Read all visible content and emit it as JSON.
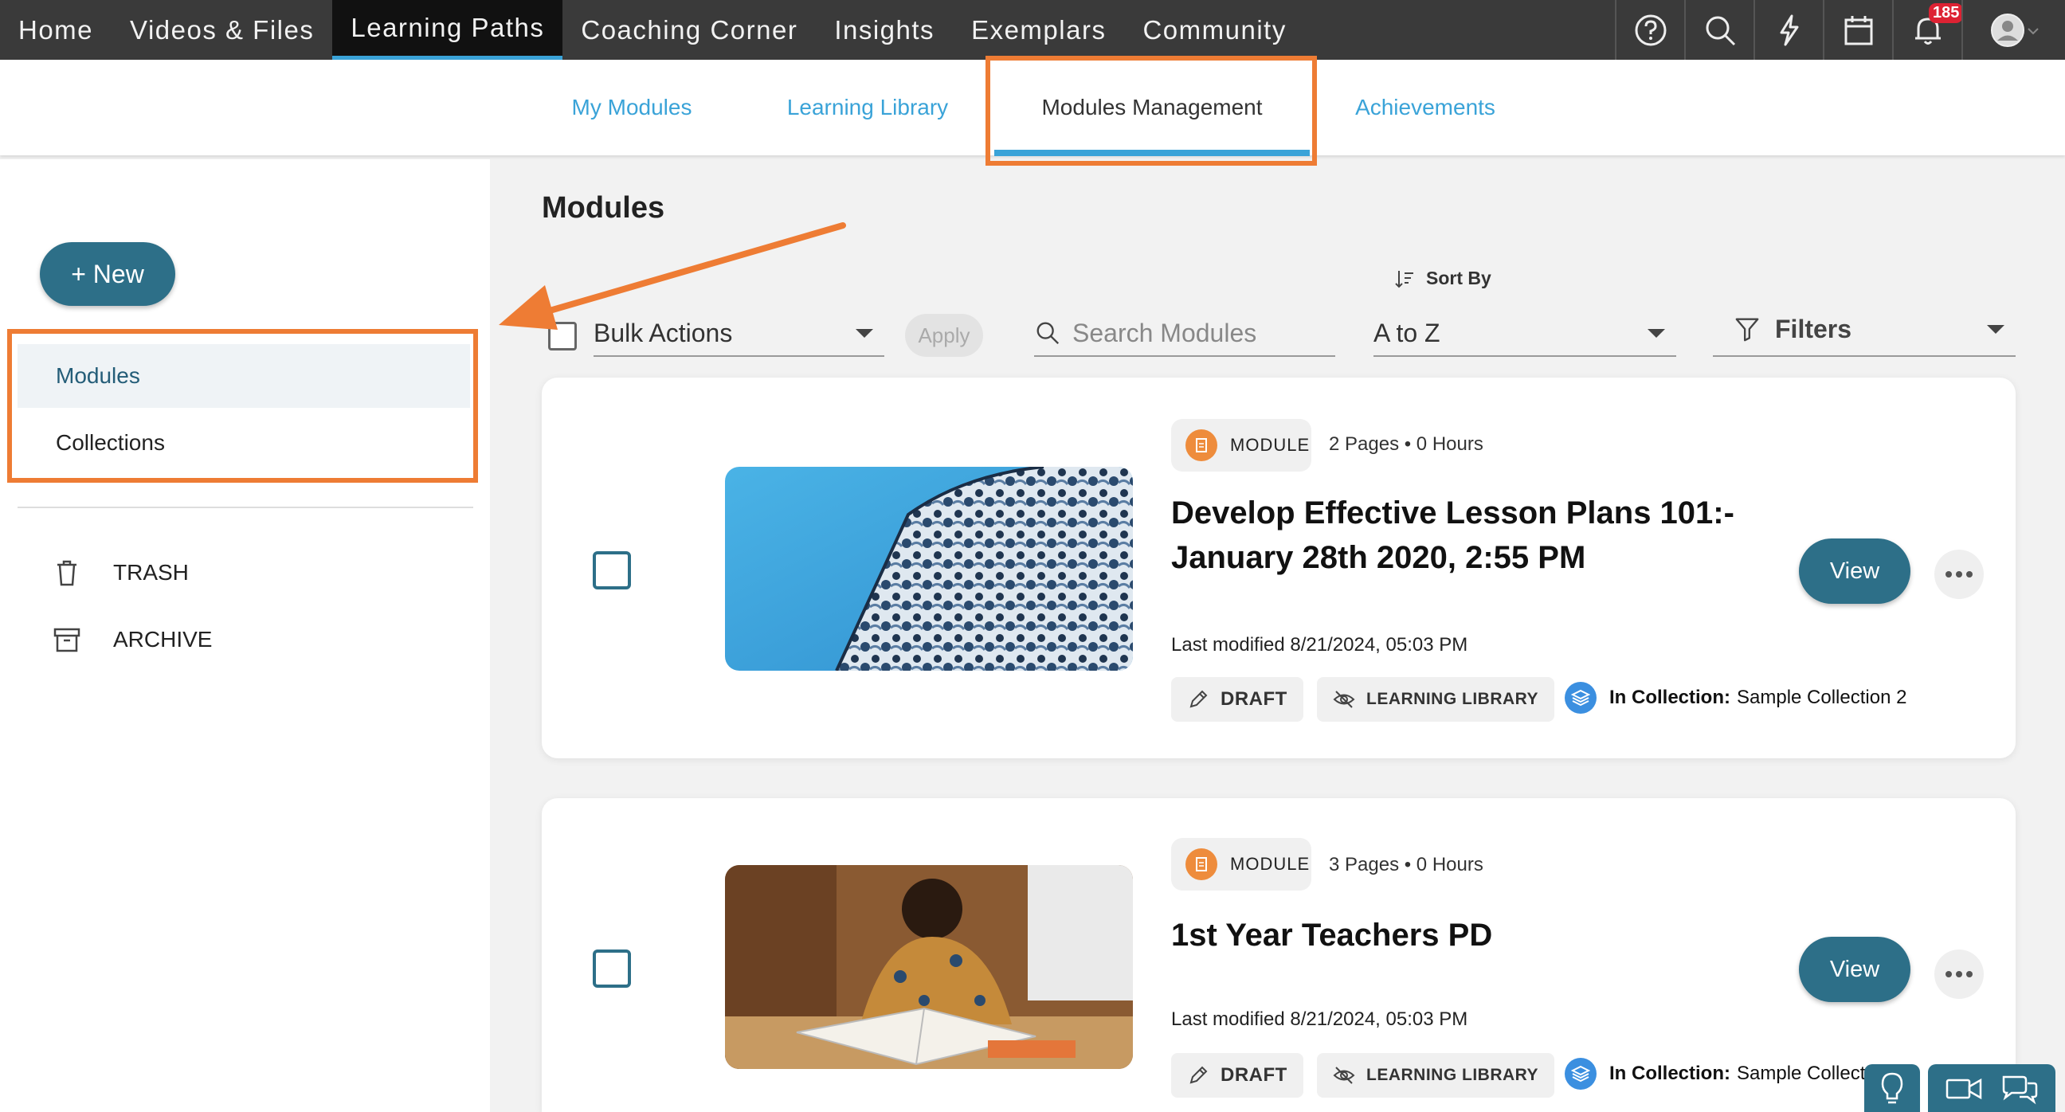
{
  "topnav": {
    "items": [
      "Home",
      "Videos & Files",
      "Learning Paths",
      "Coaching Corner",
      "Insights",
      "Exemplars",
      "Community"
    ],
    "active_index": 2,
    "notification_count": "185",
    "icons": [
      "help-icon",
      "search-icon",
      "lightning-icon",
      "calendar-icon",
      "bell-icon",
      "avatar-icon"
    ]
  },
  "subnav": {
    "tabs": [
      "My Modules",
      "Learning Library",
      "Modules Management",
      "Achievements"
    ],
    "active_index": 2
  },
  "sidebar": {
    "new_button": "+ New",
    "items": [
      "Modules",
      "Collections"
    ],
    "active_index": 0,
    "utilities": [
      "TRASH",
      "ARCHIVE"
    ]
  },
  "main": {
    "title": "Modules",
    "bulk_actions": "Bulk Actions",
    "apply": "Apply",
    "search_placeholder": "Search Modules",
    "sort_by_label": "Sort By",
    "sort_value": "A to Z",
    "filters": "Filters"
  },
  "modules": [
    {
      "type": "MODULE",
      "meta": "2 Pages • 0 Hours",
      "title": "Develop Effective Lesson Plans 101:- January 28th 2020, 2:55 PM",
      "modified": "Last modified 8/21/2024, 05:03 PM",
      "status": "DRAFT",
      "library": "LEARNING LIBRARY",
      "collection_label": "In Collection:",
      "collection_name": "Sample Collection 2",
      "view": "View"
    },
    {
      "type": "MODULE",
      "meta": "3 Pages • 0 Hours",
      "title": "1st Year Teachers PD",
      "modified": "Last modified 8/21/2024, 05:03 PM",
      "status": "DRAFT",
      "library": "LEARNING LIBRARY",
      "collection_label": "In Collection:",
      "collection_name": "Sample Collect",
      "view": "View"
    }
  ],
  "colors": {
    "accent": "#2d6f88",
    "link": "#3aa3d8",
    "highlight": "#ee7c34",
    "nav_bg": "#3a3a3a"
  }
}
